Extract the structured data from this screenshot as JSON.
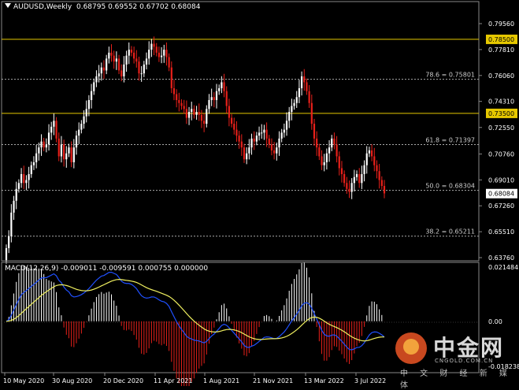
{
  "header": {
    "symbol": "AUDUSD,Weekly",
    "ohlc": "0.68795 0.69552 0.67702 0.68084"
  },
  "macd": {
    "label": "MACD(12,26,9) -0.009011 -0.009591 0.000755 0.000000",
    "axis_labels": [
      "0.021484",
      "0.00",
      "-0.018238"
    ]
  },
  "price_axis": {
    "labels": [
      "0.79560",
      "0.77810",
      "0.76060",
      "0.74310",
      "0.72550",
      "0.70760",
      "0.69010",
      "0.67260",
      "0.65510",
      "0.63760"
    ],
    "current_price": "0.68084"
  },
  "levels": [
    {
      "label": "0.78500",
      "price": 0.785,
      "color": "#e6c800"
    },
    {
      "label": "0.73500",
      "price": 0.735,
      "color": "#e6c800"
    }
  ],
  "fibonacci": [
    {
      "label": "78.6 = 0.75801",
      "price": 0.75801
    },
    {
      "label": "61.8 = 0.71397",
      "price": 0.71397
    },
    {
      "label": "50.0 = 0.68304",
      "price": 0.68304
    },
    {
      "label": "38.2 = 0.65211",
      "price": 0.65211
    }
  ],
  "time_axis": [
    "10 May 2020",
    "30 Aug 2020",
    "20 Dec 2020",
    "11 Apr 2021",
    "1 Aug 2021",
    "21 Nov 2021",
    "13 Mar 2022",
    "3 Jul 2022"
  ],
  "watermark": {
    "brand": "中金网",
    "domain": "CNGOLD.COM.CN",
    "tagline": "中 文 财 经 新 媒 体"
  },
  "colors": {
    "bull": "#ffffff",
    "bear": "#e8201a",
    "level": "#e6c800",
    "macd_main": "#2050ff",
    "macd_signal": "#f0f060",
    "background": "#000000"
  },
  "chart_data": {
    "type": "candlestick",
    "axis_range": {
      "min": 0.6376,
      "max": 0.7956
    },
    "closes": [
      0.644,
      0.652,
      0.668,
      0.676,
      0.684,
      0.688,
      0.694,
      0.688,
      0.69,
      0.694,
      0.7,
      0.702,
      0.708,
      0.712,
      0.716,
      0.712,
      0.714,
      0.722,
      0.726,
      0.73,
      0.718,
      0.706,
      0.714,
      0.704,
      0.708,
      0.712,
      0.702,
      0.712,
      0.72,
      0.724,
      0.728,
      0.733,
      0.738,
      0.744,
      0.75,
      0.756,
      0.76,
      0.762,
      0.766,
      0.764,
      0.772,
      0.776,
      0.774,
      0.77,
      0.772,
      0.764,
      0.76,
      0.768,
      0.774,
      0.778,
      0.776,
      0.772,
      0.77,
      0.762,
      0.762,
      0.768,
      0.772,
      0.778,
      0.782,
      0.78,
      0.776,
      0.773,
      0.774,
      0.778,
      0.773,
      0.766,
      0.752,
      0.748,
      0.744,
      0.742,
      0.74,
      0.738,
      0.732,
      0.736,
      0.738,
      0.734,
      0.736,
      0.734,
      0.73,
      0.728,
      0.738,
      0.744,
      0.746,
      0.744,
      0.75,
      0.752,
      0.756,
      0.75,
      0.74,
      0.732,
      0.728,
      0.724,
      0.72,
      0.716,
      0.712,
      0.704,
      0.708,
      0.712,
      0.718,
      0.716,
      0.72,
      0.722,
      0.722,
      0.724,
      0.718,
      0.714,
      0.71,
      0.708,
      0.712,
      0.718,
      0.722,
      0.724,
      0.73,
      0.736,
      0.74,
      0.742,
      0.746,
      0.752,
      0.76,
      0.756,
      0.75,
      0.742,
      0.728,
      0.718,
      0.712,
      0.706,
      0.7,
      0.702,
      0.708,
      0.712,
      0.718,
      0.714,
      0.706,
      0.698,
      0.694,
      0.688,
      0.684,
      0.682,
      0.688,
      0.692,
      0.694,
      0.688,
      0.694,
      0.7,
      0.708,
      0.71,
      0.706,
      0.7,
      0.696,
      0.69,
      0.686,
      0.681
    ]
  }
}
